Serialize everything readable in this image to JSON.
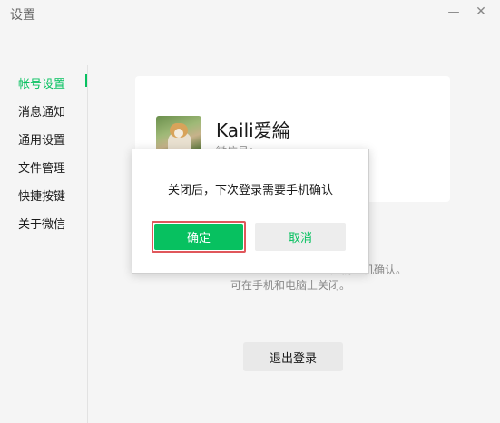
{
  "window": {
    "title": "设置",
    "minimize_glyph": "—",
    "close_glyph": "✕"
  },
  "sidebar": {
    "items": [
      {
        "label": "帐号设置",
        "active": true
      },
      {
        "label": "消息通知",
        "active": false
      },
      {
        "label": "通用设置",
        "active": false
      },
      {
        "label": "文件管理",
        "active": false
      },
      {
        "label": "快捷按键",
        "active": false
      },
      {
        "label": "关于微信",
        "active": false
      }
    ]
  },
  "profile": {
    "nickname": "Kaili爱綸",
    "wechat_id": "微信号：",
    "avatar_icon": "cat-photo"
  },
  "note": {
    "line1": "无需手机确认。",
    "line2": "可在手机和电脑上关闭。"
  },
  "logout": {
    "label": "退出登录"
  },
  "dialog": {
    "message": "关闭后，下次登录需要手机确认",
    "confirm_label": "确定",
    "cancel_label": "取消"
  },
  "colors": {
    "accent": "#07c160",
    "highlight_border": "#e0575b",
    "background": "#f5f5f5"
  }
}
